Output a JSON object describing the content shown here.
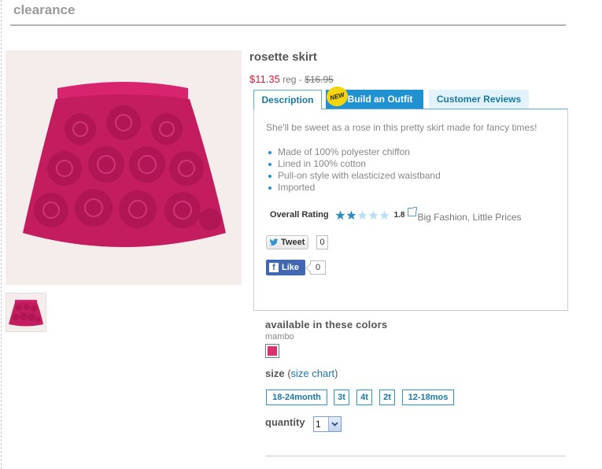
{
  "header": {
    "section_title": "clearance"
  },
  "product": {
    "name": "rosette skirt",
    "sale_price": "$11.35",
    "reg_label": "reg - ",
    "original_price": "$16.95",
    "image_color": "#c8206a"
  },
  "tabs": [
    {
      "label": "Description",
      "active": true
    },
    {
      "label": "Build an Outfit",
      "badge": "NEW"
    },
    {
      "label": "Customer Reviews"
    }
  ],
  "description": {
    "text": "She'll be sweet as a rose in this pretty skirt made for fancy times!",
    "features": [
      "Made of 100% polyester chiffon",
      "Lined in 100% cotton",
      "Pull-on style with elasticized waistband",
      "Imported"
    ]
  },
  "rating": {
    "label": "Overall Rating",
    "value": "1.8",
    "stars_filled": 2,
    "stars_total": 5,
    "brand_text": "Big Fashion, Little Prices"
  },
  "social": {
    "tweet_label": "Tweet",
    "tweet_count": "0",
    "like_label": "Like",
    "like_count": "0"
  },
  "colors": {
    "heading": "available in these colors",
    "selected_name": "mambo",
    "swatch_hex": "#d8336e"
  },
  "size": {
    "heading": "size",
    "open_paren": " (",
    "chart_link": "size chart",
    "close_paren": ")",
    "options": [
      "18-24month",
      "3t",
      "4t",
      "2t",
      "12-18mos"
    ]
  },
  "quantity": {
    "label": "quantity",
    "value": "1"
  },
  "colors_theme": {
    "accent": "#2092d2",
    "sale_red": "#e0163a",
    "link_blue": "#1a78a8"
  }
}
